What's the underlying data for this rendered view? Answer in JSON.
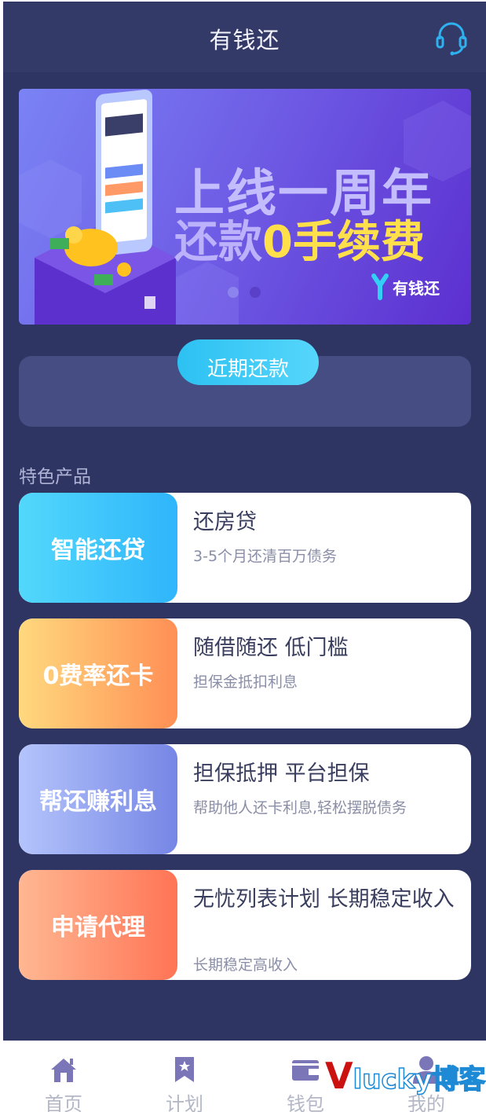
{
  "app": {
    "title": "有钱还"
  },
  "banner": {
    "headline_1": "上线一周年",
    "headline_2_prefix": "还款",
    "headline_2_highlight": "0手续费",
    "brand": "有钱还",
    "slides": 2,
    "active_slide": 2
  },
  "recent": {
    "label": "近期还款"
  },
  "products": {
    "section_title": "特色产品",
    "items": [
      {
        "tag": "智能还贷",
        "title": "还房贷",
        "desc": "3-5个月还清百万债务",
        "gradient": [
          "#52d8fb",
          "#2fb5fb"
        ]
      },
      {
        "tag": "0费率还卡",
        "title": "随借随还 低门槛",
        "desc": "担保金抵扣利息",
        "gradient": [
          "#ffd97e",
          "#ff8f55"
        ]
      },
      {
        "tag": "帮还赚利息",
        "title": "担保抵押 平台担保",
        "desc": "帮助他人还卡利息,轻松摆脱债务",
        "gradient": [
          "#b4c4fb",
          "#7686e5"
        ]
      },
      {
        "tag": "申请代理",
        "title": "无忧列表计划 长期稳定收入",
        "desc": "长期稳定高收入",
        "gradient": [
          "#ffb792",
          "#ff7455"
        ]
      }
    ]
  },
  "tabbar": {
    "items": [
      {
        "label": "首页",
        "icon": "home-icon"
      },
      {
        "label": "计划",
        "icon": "bookmark-star-icon"
      },
      {
        "label": "钱包",
        "icon": "wallet-icon"
      },
      {
        "label": "我的",
        "icon": "user-icon"
      }
    ]
  },
  "watermark": {
    "v": "V",
    "rest": "lucky博客"
  },
  "colors": {
    "background": "#2f3563",
    "header": "#343a67",
    "panel": "#464d82",
    "accent": "#2cc1f2",
    "tab_icon": "#7b76b8"
  }
}
